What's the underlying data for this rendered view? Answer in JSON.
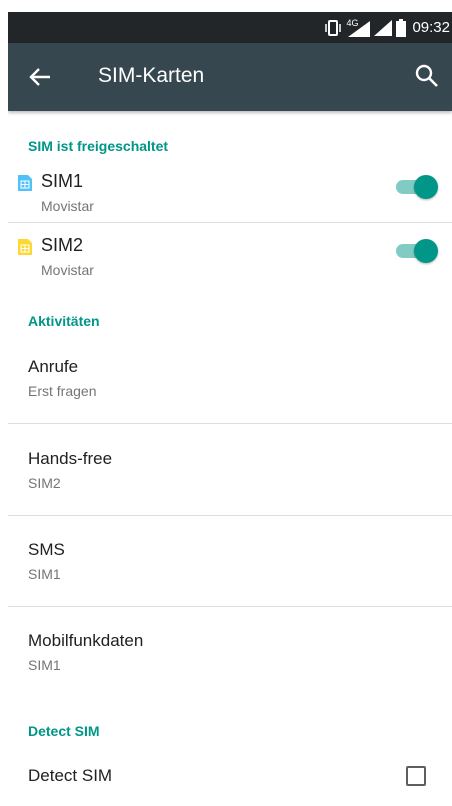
{
  "status_bar": {
    "time": "09:32",
    "network_label": "4G"
  },
  "toolbar": {
    "title": "SIM-Karten"
  },
  "sim_section": {
    "header": "SIM ist freigeschaltet",
    "sims": [
      {
        "name": "SIM1",
        "carrier": "Movistar",
        "enabled": true,
        "icon_color": "#4fc3f7"
      },
      {
        "name": "SIM2",
        "carrier": "Movistar",
        "enabled": true,
        "icon_color": "#fdd835"
      }
    ]
  },
  "activities": {
    "header": "Aktivitäten",
    "items": [
      {
        "title": "Anrufe",
        "value": "Erst fragen"
      },
      {
        "title": "Hands-free",
        "value": "SIM2"
      },
      {
        "title": "SMS",
        "value": "SIM1"
      },
      {
        "title": "Mobilfunkdaten",
        "value": "SIM1"
      }
    ]
  },
  "detect": {
    "header": "Detect SIM",
    "label": "Detect SIM",
    "checked": false
  },
  "colors": {
    "accent": "#009688",
    "toolbar": "#37474f",
    "statusbar": "#222629"
  }
}
